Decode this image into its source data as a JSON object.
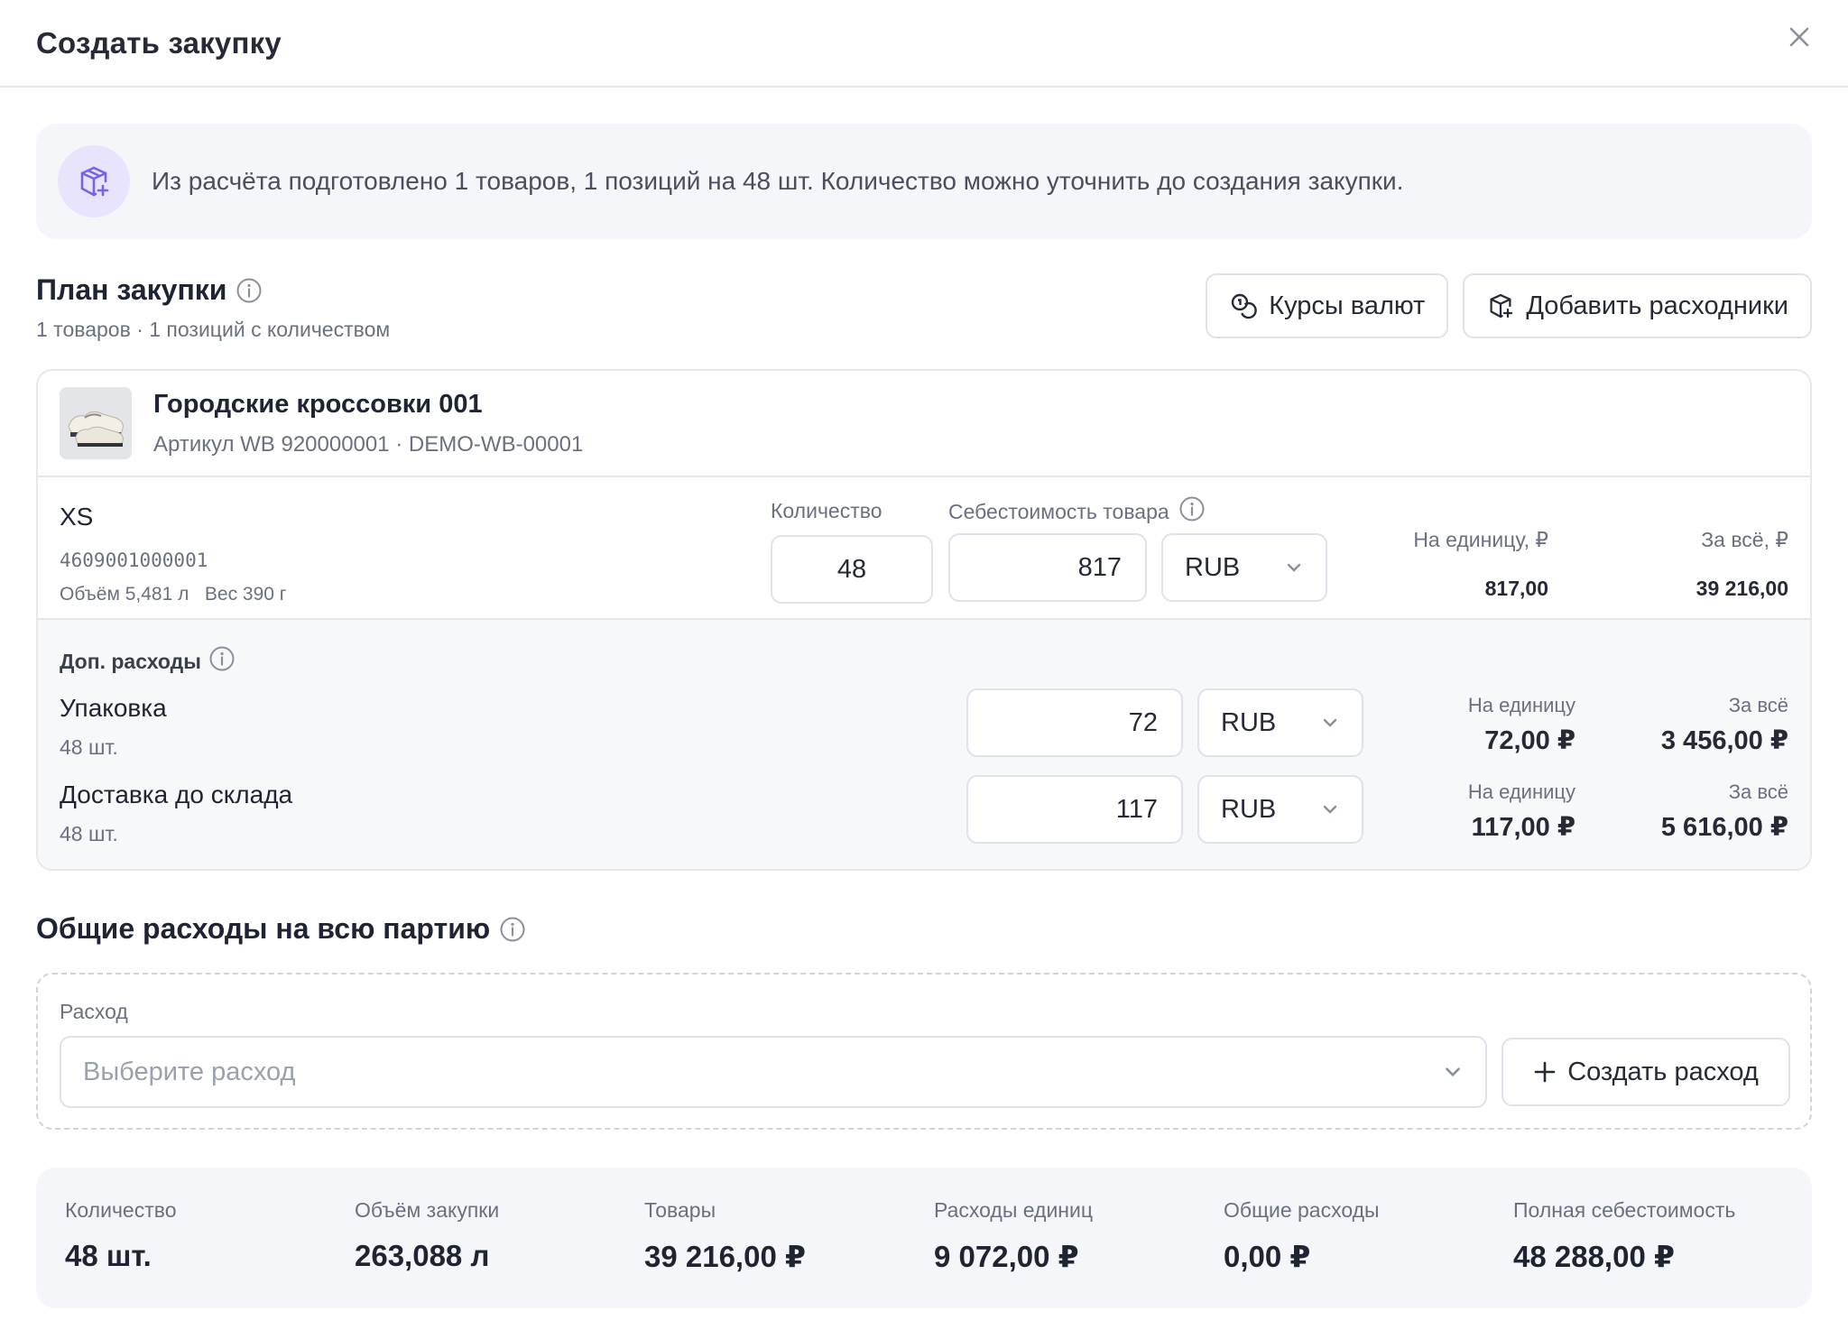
{
  "modal": {
    "title": "Создать закупку"
  },
  "banner": {
    "text": "Из расчёта подготовлено 1 товаров, 1 позиций на 48 шт. Количество можно уточнить до создания закупки."
  },
  "plan": {
    "title": "План закупки",
    "subtitle": "1 товаров · 1 позиций с количеством",
    "exchange_rates_label": "Курсы валют",
    "add_consumables_label": "Добавить расходники"
  },
  "product": {
    "name": "Городские кроссовки 001",
    "meta": "Артикул WB 920000001 · DEMO-WB-00001",
    "variant": {
      "size": "XS",
      "barcode": "4609001000001",
      "dims": "Объём 5,481 л   Вес 390 г",
      "quantity_label": "Количество",
      "quantity": "48",
      "cost_label": "Себестоимость товара",
      "cost": "817",
      "currency": "RUB",
      "per_unit_label": "На единицу, ₽",
      "per_unit_value": "817,00",
      "total_label": "За всё, ₽",
      "total_value": "39 216,00"
    }
  },
  "extras": {
    "title": "Доп. расходы",
    "items": [
      {
        "name": "Упаковка",
        "qty": "48 шт.",
        "amount": "72",
        "currency": "RUB",
        "per_unit_label": "На единицу",
        "per_unit": "72,00 ₽",
        "total_label": "За всё",
        "total": "3 456,00 ₽"
      },
      {
        "name": "Доставка до склада",
        "qty": "48 шт.",
        "amount": "117",
        "currency": "RUB",
        "per_unit_label": "На единицу",
        "per_unit": "117,00 ₽",
        "total_label": "За всё",
        "total": "5 616,00 ₽"
      }
    ]
  },
  "general": {
    "title": "Общие расходы на всю партию",
    "cost_label": "Расход",
    "cost_placeholder": "Выберите расход",
    "create_label": "Создать расход"
  },
  "summary": [
    {
      "label": "Количество",
      "value": "48 шт."
    },
    {
      "label": "Объём закупки",
      "value": "263,088 л"
    },
    {
      "label": "Товары",
      "value": "39 216,00 ₽"
    },
    {
      "label": "Расходы единиц",
      "value": "9 072,00 ₽"
    },
    {
      "label": "Общие расходы",
      "value": "0,00 ₽"
    },
    {
      "label": "Полная себестоимость",
      "value": "48 288,00 ₽"
    }
  ],
  "colors": {
    "accent_icon_bg": "#e8e4fd",
    "accent_icon": "#7b61e8",
    "text_primary": "#1f2433",
    "text_muted": "#6b7080"
  }
}
